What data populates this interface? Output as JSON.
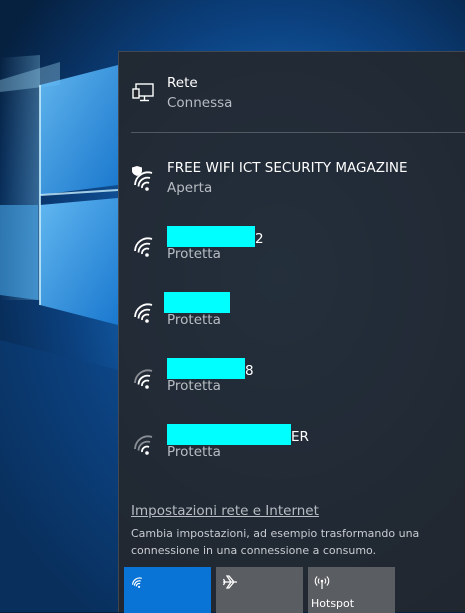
{
  "wired": {
    "name": "Rete",
    "status": "Connessa"
  },
  "networks": [
    {
      "name": "FREE WIFI ICT SECURITY MAGAZINE",
      "status": "Aperta"
    },
    {
      "name_suffix": "2",
      "status": "Protetta"
    },
    {
      "name_suffix": "",
      "status": "Protetta"
    },
    {
      "name_suffix": "8",
      "status": "Protetta"
    },
    {
      "name_suffix": "ER",
      "status": "Protetta"
    }
  ],
  "settings": {
    "link": "Impostazioni rete e Internet",
    "description": "Cambia impostazioni, ad esempio trasformando una connessione in una connessione a consumo."
  },
  "quick_actions": [
    {
      "label": "",
      "icon": "wifi-icon",
      "active": true
    },
    {
      "label": "",
      "icon": "airplane-icon",
      "active": false
    },
    {
      "label": "Hotspot",
      "icon": "hotspot-icon",
      "active": false
    }
  ],
  "colors": {
    "accent": "#0a74d6",
    "redaction": "#00ffff",
    "flyout_bg": "#24282e"
  }
}
